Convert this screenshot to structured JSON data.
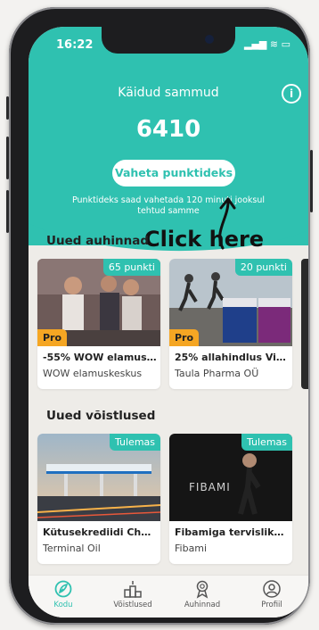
{
  "status_bar": {
    "time": "16:22",
    "icons": "▂▄▆ ≋ ▭"
  },
  "header": {
    "title": "Käidud sammud",
    "steps": "6410",
    "exchange_button": "Vaheta punktideks",
    "note": "Punktideks saad vahetada 120 minuti jooksul tehtud samme",
    "info_label": "i"
  },
  "callout": {
    "label": "Click here"
  },
  "sections": {
    "prizes_title": "Uued auhinnad",
    "competitions_title": "Uued võistlused"
  },
  "prizes": [
    {
      "badge": "65 punkti",
      "pro": "Pro",
      "title": "-55% WOW elamus...",
      "subtitle": "WOW elamuskeskus"
    },
    {
      "badge": "20 punkti",
      "pro": "Pro",
      "title": "25% allahindlus Vit...",
      "subtitle": "Taula Pharma OÜ"
    }
  ],
  "competitions": [
    {
      "badge": "Tulemas",
      "title": "Kütusekrediidi Chal...",
      "subtitle": "Terminal Oil"
    },
    {
      "badge": "Tulemas",
      "title": "Fibamiga tervislikul...",
      "subtitle": "Fibami",
      "image_text": "FIBAMI"
    }
  ],
  "tabbar": [
    {
      "label": "Kodu",
      "icon": "leaf-icon",
      "active": true
    },
    {
      "label": "Võistlused",
      "icon": "podium-icon",
      "active": false
    },
    {
      "label": "Auhinnad",
      "icon": "medal-icon",
      "active": false
    },
    {
      "label": "Profiil",
      "icon": "profile-icon",
      "active": false
    }
  ],
  "colors": {
    "accent": "#2fc1b0",
    "pro_badge": "#f5a623",
    "background": "#eeece8"
  }
}
